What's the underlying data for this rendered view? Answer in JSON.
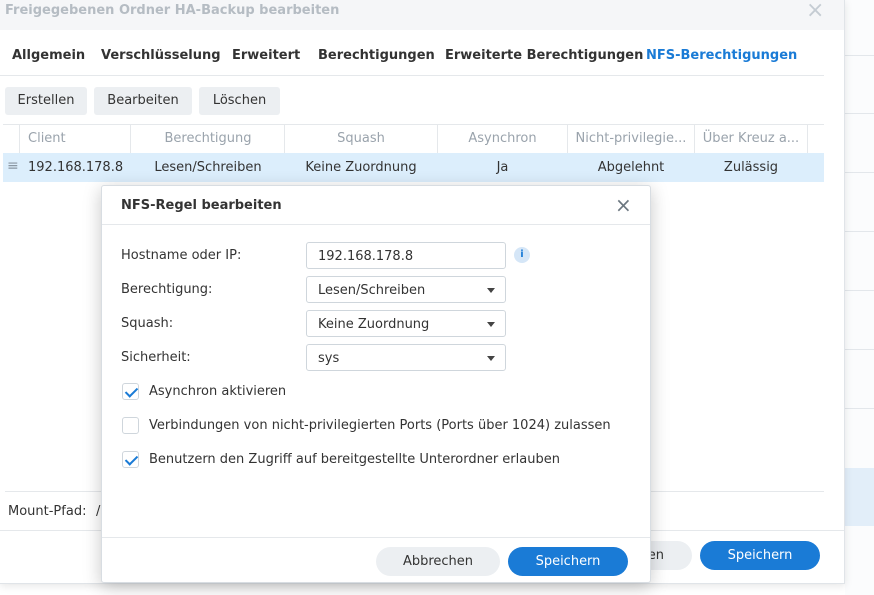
{
  "outer_dialog": {
    "title": "Freigegebenen Ordner HA-Backup bearbeiten",
    "close_glyph": "×",
    "tabs": [
      {
        "label": "Allgemein"
      },
      {
        "label": "Verschlüsselung"
      },
      {
        "label": "Erweitert"
      },
      {
        "label": "Berechtigungen"
      },
      {
        "label": "Erweiterte Berechtigungen"
      },
      {
        "label": "NFS-Berechtigungen"
      }
    ],
    "active_tab": "NFS-Berechtigungen",
    "toolbar": {
      "create": "Erstellen",
      "edit": "Bearbeiten",
      "delete": "Löschen"
    },
    "table": {
      "columns": [
        "Client",
        "Berechtigung",
        "Squash",
        "Asynchron",
        "Nicht-privilegie...",
        "Über Kreuz a..."
      ],
      "rows": [
        [
          "192.168.178.8",
          "Lesen/Schreiben",
          "Keine Zuordnung",
          "Ja",
          "Abgelehnt",
          "Zulässig"
        ]
      ]
    },
    "mount_label": "Mount-Pfad:",
    "mount_value": "/",
    "cancel_visible": "en",
    "save": "Speichern"
  },
  "modal": {
    "title": "NFS-Regel bearbeiten",
    "close_glyph": "×",
    "fields": {
      "hostname_label": "Hostname oder IP:",
      "hostname_value": "192.168.178.8",
      "permission_label": "Berechtigung:",
      "permission_value": "Lesen/Schreiben",
      "squash_label": "Squash:",
      "squash_value": "Keine Zuordnung",
      "security_label": "Sicherheit:",
      "security_value": "sys"
    },
    "checkboxes": [
      {
        "label": "Asynchron aktivieren",
        "checked": true
      },
      {
        "label": "Verbindungen von nicht-privilegierten Ports (Ports über 1024) zulassen",
        "checked": false
      },
      {
        "label": "Benutzern den Zugriff auf bereitgestellte Unterordner erlauben",
        "checked": true
      }
    ],
    "cancel": "Abbrechen",
    "save": "Speichern"
  },
  "colors": {
    "accent": "#1a7bd6",
    "row_selected": "#dceefc"
  }
}
